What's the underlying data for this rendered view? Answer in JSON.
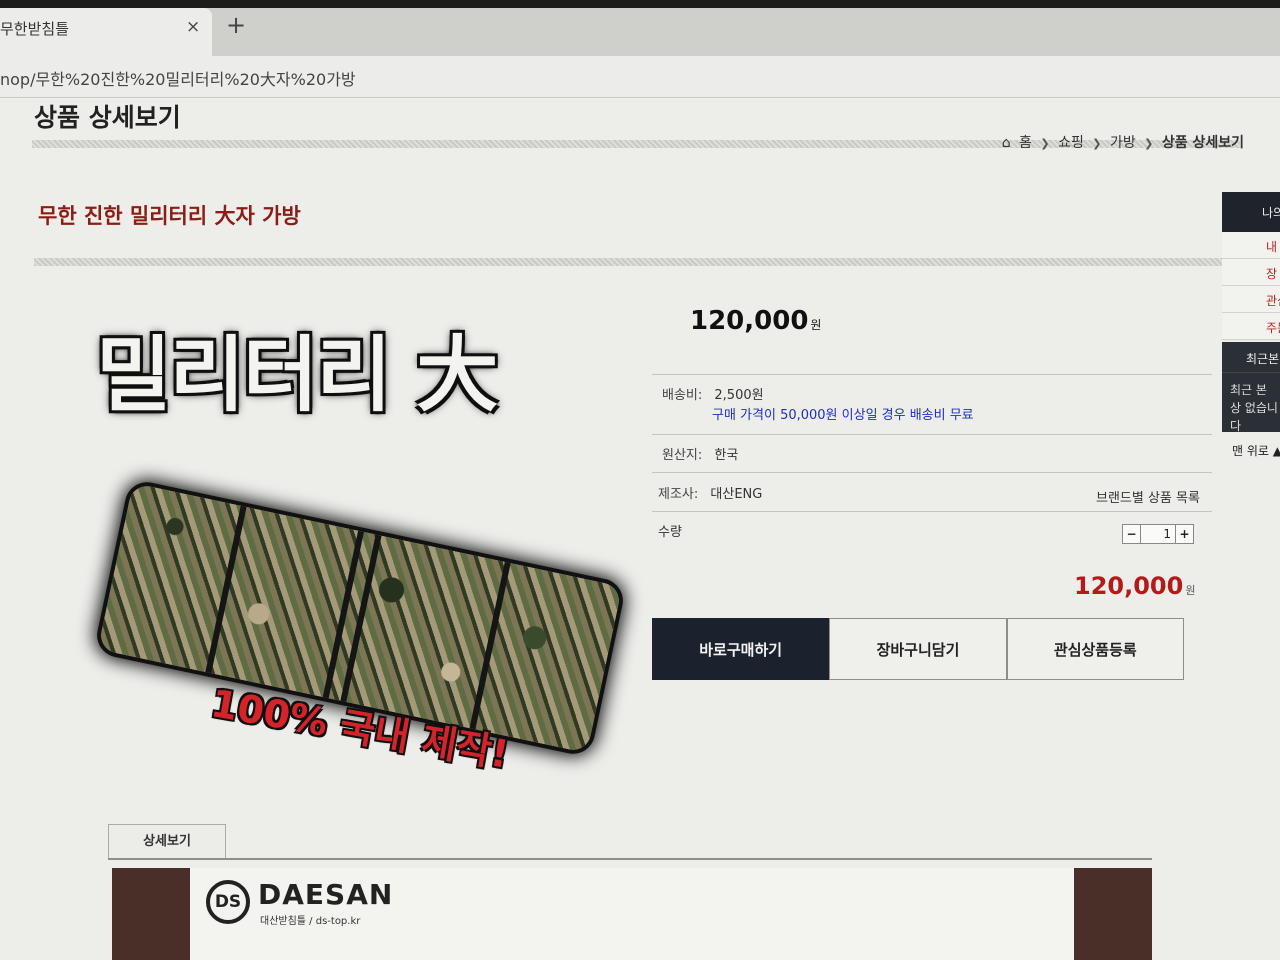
{
  "browser": {
    "tab_title": "무한받침틀",
    "tab_close": "×",
    "new_tab": "+",
    "url": "nop/무한%20진한%20밀리터리%20大자%20가방"
  },
  "page": {
    "title": "상품 상세보기",
    "breadcrumb": [
      "홈",
      "쇼핑",
      "가방",
      "상품 상세보기"
    ],
    "product_name": "무한 진한 밀리터리 大자 가방"
  },
  "promo": {
    "headline": "밀리터리 大",
    "subline": "100% 국내 제작!"
  },
  "info": {
    "price": "120,000",
    "currency": "원",
    "shipping_label": "배송비:",
    "shipping_value": "2,500원",
    "shipping_note": "구매 가격이 50,000원 이상일 경우 배송비 무료",
    "origin_label": "원산지:",
    "origin_value": "한국",
    "maker_label": "제조사:",
    "maker_value": "대산ENG",
    "brand_link": "브랜드별 상품 목록",
    "qty_label": "수량",
    "qty_minus": "−",
    "qty_value": "1",
    "qty_plus": "+",
    "total_price": "120,000",
    "total_currency": "원"
  },
  "actions": {
    "buy_now": "바로구매하기",
    "add_cart": "장바구니담기",
    "wishlist": "관심상품등록"
  },
  "sidebar": {
    "head": "나의",
    "items": [
      "내",
      "장",
      "관심",
      "주문"
    ],
    "recent": "최근본",
    "recent_empty": "최근 본 상 없습니다",
    "to_top": "맨 위로 ▲"
  },
  "detail": {
    "tab": "상세보기",
    "logo_mark": "DS",
    "brand": "DAESAN",
    "brand_sub": "대산받침틀 / ds-top.kr"
  }
}
